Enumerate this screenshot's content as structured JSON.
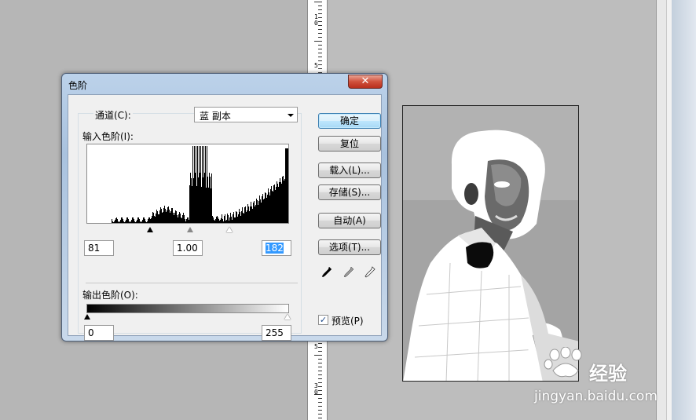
{
  "dialog": {
    "title": "色阶",
    "close_label": "✕",
    "channel_label": "通道(C):",
    "channel_value": "蓝 副本",
    "input_levels_label": "输入色阶(I):",
    "input_black": "81",
    "input_gamma": "1.00",
    "input_white": "182",
    "output_levels_label": "输出色阶(O):",
    "output_black": "0",
    "output_white": "255",
    "buttons": {
      "ok": "确定",
      "reset": "复位",
      "load": "载入(L)...",
      "save": "存储(S)...",
      "auto": "自动(A)",
      "options": "选项(T)..."
    },
    "preview_label": "预览(P)",
    "preview_checked": true,
    "eyedroppers": [
      "black-eyedropper-icon",
      "gray-eyedropper-icon",
      "white-eyedropper-icon"
    ]
  },
  "ruler": {
    "labels": [
      "1\n0",
      "5",
      "5",
      "3\n0"
    ]
  },
  "watermark": {
    "brand": "经验",
    "url": "jingyan.baidu.com"
  },
  "colors": {
    "close_button": "#c8432d",
    "default_button": "#bee6fd",
    "selected_value": "#3399ff"
  }
}
